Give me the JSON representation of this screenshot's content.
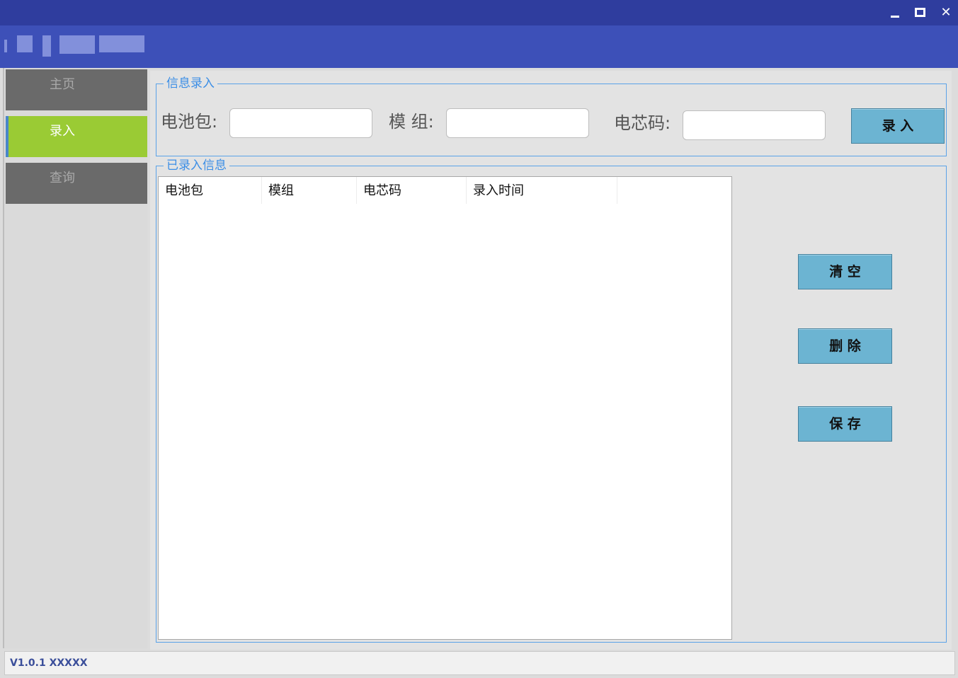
{
  "window": {
    "title": "",
    "controls": {
      "minimize_icon": "minimize-icon",
      "maximize_icon": "maximize-icon",
      "close_label": "✕"
    }
  },
  "colors": {
    "titlebar": "#2f3d9e",
    "header": "#3d50b8",
    "nav_active": "#9acb34",
    "nav_inactive": "#6a6a6a",
    "group_border": "#5aa2e8",
    "button": "#6cb4d2"
  },
  "sidebar": {
    "items": [
      {
        "label": "主页",
        "active": false
      },
      {
        "label": "录入",
        "active": true
      },
      {
        "label": "查询",
        "active": false
      }
    ]
  },
  "entry_group": {
    "title": "信息录入",
    "fields": [
      {
        "label": "电池包:",
        "value": ""
      },
      {
        "label": "模 组:",
        "value": ""
      },
      {
        "label": "电芯码:",
        "value": ""
      }
    ],
    "submit_label": "录 入"
  },
  "list_group": {
    "title": "已录入信息",
    "columns": [
      "电池包",
      "模组",
      "电芯码",
      "录入时间"
    ],
    "rows": [],
    "buttons": {
      "clear": "清 空",
      "delete": "删 除",
      "save": "保 存"
    }
  },
  "statusbar": {
    "version": "V1.0.1 XXXXX"
  }
}
